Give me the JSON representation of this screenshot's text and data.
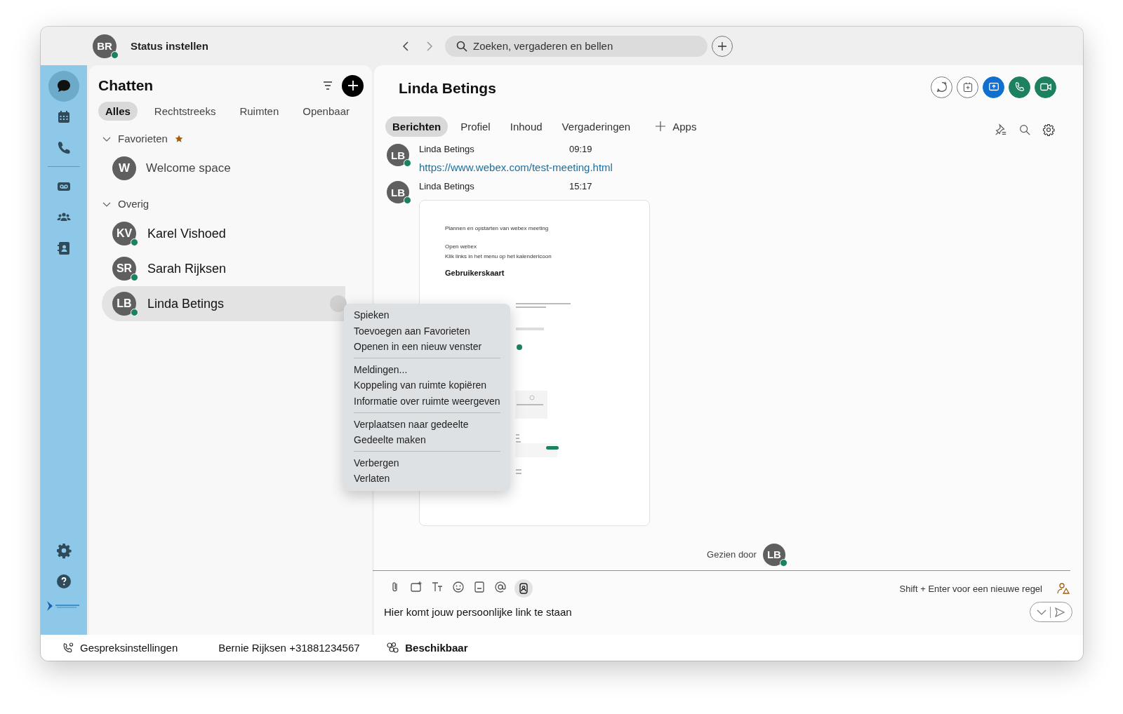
{
  "titlebar": {
    "avatar": {
      "initials": "BR",
      "online": true
    },
    "status_text": "Status instellen",
    "search": {
      "placeholder": "Zoeken, vergaderen en bellen"
    }
  },
  "rail": {
    "groups": [
      [
        {
          "kind": "chat",
          "selected": true
        },
        {
          "kind": "calendar",
          "selected": false
        },
        {
          "kind": "calls",
          "selected": false
        }
      ],
      [
        {
          "kind": "voicemail",
          "selected": false
        },
        {
          "kind": "teams",
          "selected": false
        },
        {
          "kind": "contacts",
          "selected": false
        }
      ]
    ],
    "bottom": [
      {
        "kind": "settings",
        "selected": false
      },
      {
        "kind": "help",
        "selected": false
      }
    ]
  },
  "chat_list": {
    "title": "Chatten",
    "filters": [
      {
        "label": "Alles",
        "selected": true
      },
      {
        "label": "Rechtstreeks",
        "selected": false
      },
      {
        "label": "Ruimten",
        "selected": false
      },
      {
        "label": "Openbaar",
        "selected": false
      }
    ],
    "sections": [
      {
        "label": "Favorieten",
        "expanded": true,
        "starred": true,
        "items": [
          {
            "kind": "space",
            "initials": "W",
            "name": "Welcome space",
            "online": false,
            "selected": false
          }
        ]
      },
      {
        "label": "Overig",
        "expanded": true,
        "items": [
          {
            "kind": "person",
            "initials": "KV",
            "name": "Karel Vishoed",
            "online": true,
            "selected": false
          },
          {
            "kind": "person",
            "initials": "SR",
            "name": "Sarah Rijksen",
            "online": true,
            "selected": false
          },
          {
            "kind": "person",
            "initials": "LB",
            "name": "Linda Betings",
            "online": true,
            "selected": true
          }
        ]
      }
    ]
  },
  "conversation": {
    "title": "Linda Betings",
    "tabs": [
      {
        "label": "Berichten",
        "selected": true
      },
      {
        "label": "Profiel",
        "selected": false
      },
      {
        "label": "Inhoud",
        "selected": false
      },
      {
        "label": "Vergaderingen",
        "selected": false
      }
    ],
    "apps_label": "Apps",
    "messages": [
      {
        "kind": "link",
        "initials": "LB",
        "online": true,
        "sender": "Linda Betings",
        "time": "09:19",
        "link": "https://www.webex.com/test-meeting.html"
      },
      {
        "kind": "document",
        "initials": "LB",
        "online": true,
        "sender": "Linda Betings",
        "time": "15:17",
        "document": {
          "lines": [
            "Plannen en opstarten van webex meeting",
            "Open webex",
            "Klik links in het menu op het kalendericoon"
          ],
          "heading": "Gebruikerskaart"
        }
      }
    ],
    "seen_by": {
      "label": "Gezien door",
      "initials": "LB",
      "online": true
    },
    "composer": {
      "hint": "Shift + Enter voor een nieuwe regel",
      "value": "Hier komt jouw persoonlijke link te staan"
    }
  },
  "context_menu": {
    "groups": [
      [
        "Spieken",
        "Toevoegen aan Favorieten",
        "Openen in een nieuw venster"
      ],
      [
        "Meldingen...",
        "Koppeling van ruimte kopiëren",
        "Informatie over ruimte weergeven"
      ],
      [
        "Verplaatsen naar gedeelte",
        "Gedeelte maken"
      ],
      [
        "Verbergen",
        "Verlaten"
      ]
    ]
  },
  "status_bar": {
    "call_settings": "Gespreksinstellingen",
    "user_line": "Bernie Rijksen +31881234567",
    "availability": "Beschikbaar"
  }
}
